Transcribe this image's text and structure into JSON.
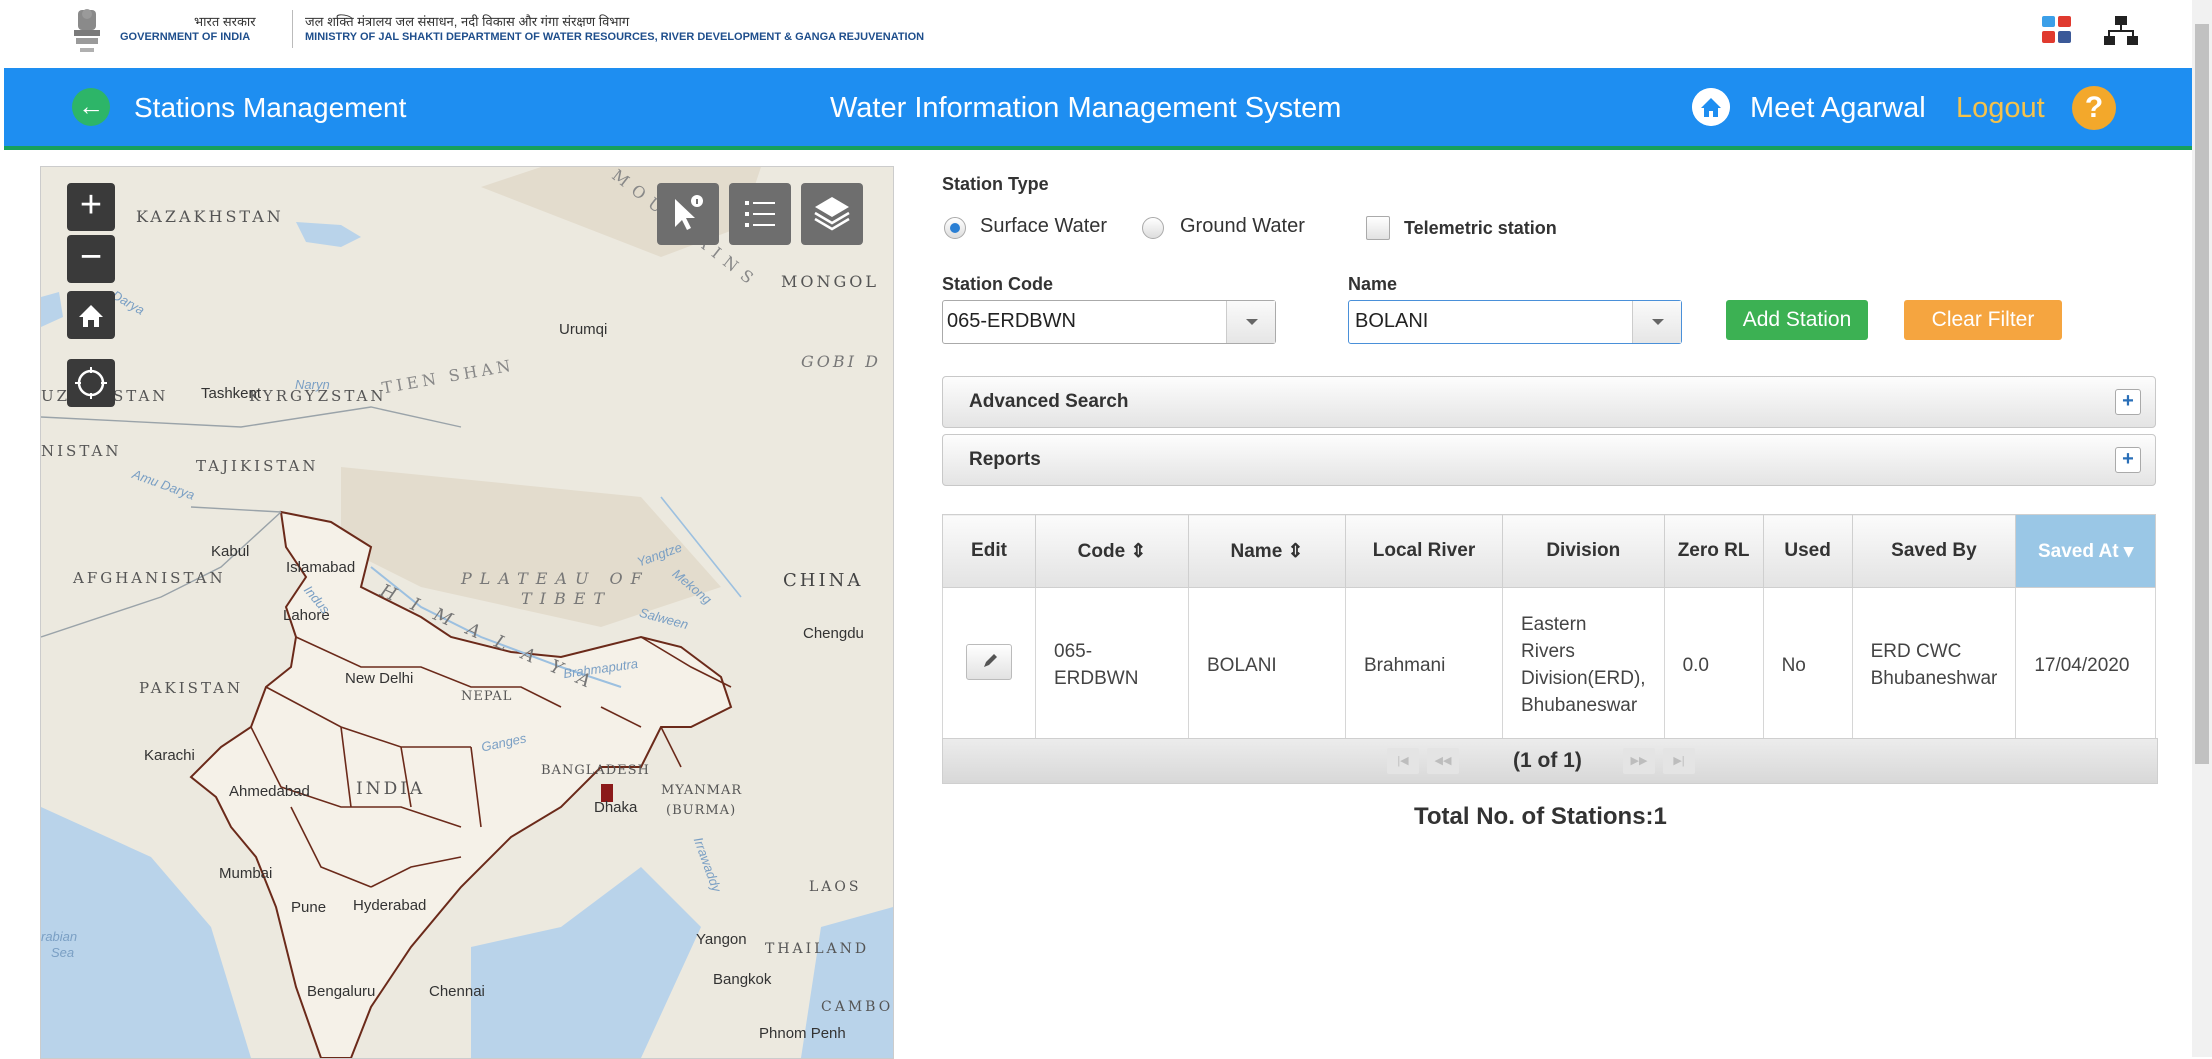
{
  "gov": {
    "hindi": "भारत सरकार",
    "english": "GOVERNMENT OF INDIA",
    "ministry_hindi": "जल शक्ति मंत्रालय जल संसाधन, नदी विकास और गंगा संरक्षण विभाग",
    "ministry_english": "MINISTRY OF JAL SHAKTI DEPARTMENT OF WATER RESOURCES, RIVER DEVELOPMENT & GANGA REJUVENATION"
  },
  "nav": {
    "page_title": "Stations Management",
    "app_title": "Water Information Management System",
    "user": "Meet Agarwal",
    "logout": "Logout",
    "help": "?"
  },
  "map": {
    "zoom_in": "+",
    "zoom_out": "−",
    "labels": {
      "kazakhstan": "KAZAKHSTAN",
      "mongol": "MONGOL",
      "altay": "ALTAY MOUNTAINS",
      "gobi": "GOBI D",
      "tian_shan": "TIEN SHAN",
      "kyrgyzstan": "KYRGYZSTAN",
      "uz": "UZ",
      "stan": "STAN",
      "nistan": "NISTAN",
      "tajikistan": "TAJIKISTAN",
      "afghanistan": "AFGHANISTAN",
      "plateau": "PLATEAU OF",
      "tibet": "TIBET",
      "china": "CHINA",
      "pakistan": "PAKISTAN",
      "nepal": "NEPAL",
      "himalaya": "H I M A L A Y A",
      "india": "INDIA",
      "bangladesh": "BANGLADESH",
      "myanmar": "MYANMAR",
      "burma": "(BURMA)",
      "laos": "LAOS",
      "thailand": "THAILAND",
      "cambo": "CAMBO",
      "arabian": "rabian",
      "sea": "Sea"
    },
    "cities": {
      "urumqi": "Urumqi",
      "tashkent": "Tashkent",
      "kabul": "Kabul",
      "islamabad": "Islamabad",
      "lahore": "Lahore",
      "new_delhi": "New Delhi",
      "chengdu": "Chengdu",
      "karachi": "Karachi",
      "ahmedabad": "Ahmedabad",
      "dhaka": "Dhaka",
      "mumbai": "Mumbai",
      "pune": "Pune",
      "hyderabad": "Hyderabad",
      "yangon": "Yangon",
      "bangkok": "Bangkok",
      "bengaluru": "Bengaluru",
      "chennai": "Chennai",
      "phnom_penh": "Phnom Penh"
    },
    "water": {
      "darya": "Darya",
      "amu": "Amu Darya",
      "yangtze": "Yangtze",
      "mekong": "Mekong",
      "indus": "Indus",
      "salween": "Salween",
      "brahmaputra": "Brahmaputra",
      "ganges": "Ganges",
      "irrawaddy": "Irrawaddy",
      "naryn": "Naryn"
    }
  },
  "filters": {
    "station_type_label": "Station Type",
    "surface_water": "Surface Water",
    "ground_water": "Ground Water",
    "telemetric": "Telemetric station",
    "selected_type": "Surface Water",
    "station_code_label": "Station Code",
    "station_code_value": "065-ERDBWN",
    "name_label": "Name",
    "name_value": "BOLANI",
    "add_station": "Add Station",
    "clear_filter": "Clear Filter"
  },
  "accordions": {
    "advanced_search": "Advanced Search",
    "reports": "Reports"
  },
  "table": {
    "headers": [
      "Edit",
      "Code ⇕",
      "Name ⇕",
      "Local River",
      "Division",
      "Zero RL",
      "Used",
      "Saved By",
      "Saved At ▾"
    ],
    "rows": [
      {
        "code": "065-ERDBWN",
        "name": "BOLANI",
        "local_river": "Brahmani",
        "division": "Eastern Rivers Division(ERD), Bhubaneswar",
        "zero_rl": "0.0",
        "used": "No",
        "saved_by": "ERD CWC Bhubaneshwar",
        "saved_at": "17/04/2020"
      }
    ],
    "pager_text": "(1 of 1)"
  },
  "total": "Total No. of Stations:1",
  "colors": {
    "nav_blue": "#1e8ef1",
    "add_green": "#3cb153",
    "clear_orange": "#f5a540",
    "logout_yellow": "#f5c24b"
  }
}
